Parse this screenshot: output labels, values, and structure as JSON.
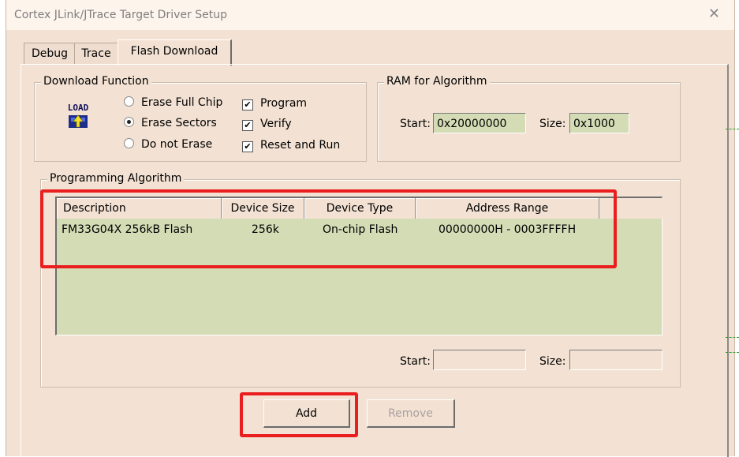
{
  "window": {
    "title": "Cortex JLink/JTrace Target Driver Setup"
  },
  "tabs": [
    {
      "label": "Debug"
    },
    {
      "label": "Trace"
    },
    {
      "label": "Flash Download"
    }
  ],
  "download_function": {
    "label": "Download Function",
    "load_icon_text": "LOAD",
    "radios": [
      {
        "label": "Erase Full Chip",
        "checked": false
      },
      {
        "label": "Erase Sectors",
        "checked": true
      },
      {
        "label": "Do not Erase",
        "checked": false
      }
    ],
    "checks": [
      {
        "label": "Program",
        "checked": true
      },
      {
        "label": "Verify",
        "checked": true
      },
      {
        "label": "Reset and Run",
        "checked": true
      }
    ]
  },
  "ram": {
    "label": "RAM for Algorithm",
    "start_label": "Start:",
    "start_value": "0x20000000",
    "size_label": "Size:",
    "size_value": "0x1000"
  },
  "programming_algorithm": {
    "label": "Programming Algorithm",
    "columns": [
      "Description",
      "Device Size",
      "Device Type",
      "Address Range"
    ],
    "rows": [
      {
        "description": "FM33G04X 256kB Flash",
        "size": "256k",
        "type": "On-chip Flash",
        "range": "00000000H - 0003FFFFH"
      }
    ],
    "start_label": "Start:",
    "start_value": "",
    "size_label": "Size:",
    "size_value": ""
  },
  "buttons": {
    "add": "Add",
    "remove": "Remove"
  },
  "colors": {
    "dialog_bg": "#f3e2d3",
    "list_bg": "#d3dcb5",
    "highlight": "#ea1e1e"
  }
}
